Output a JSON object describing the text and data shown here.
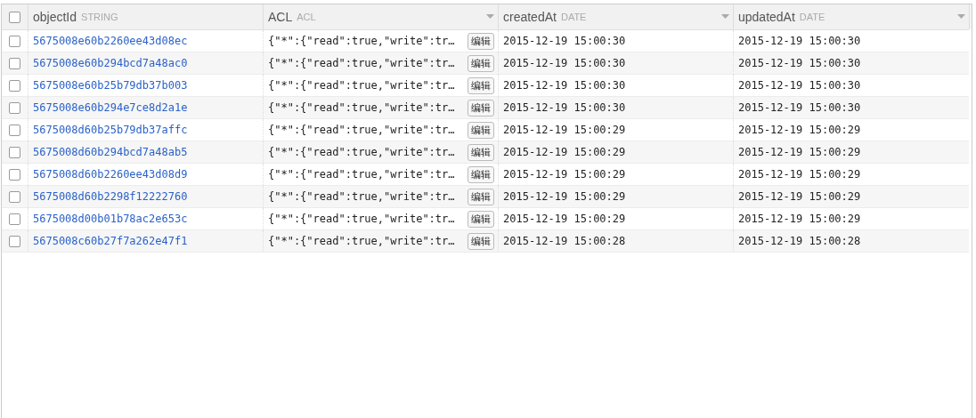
{
  "table": {
    "select_all": {
      "checked": false
    },
    "columns": [
      {
        "name": "objectId",
        "type": "STRING",
        "menu": false
      },
      {
        "name": "ACL",
        "type": "ACL",
        "menu": true
      },
      {
        "name": "createdAt",
        "type": "DATE",
        "menu": true
      },
      {
        "name": "updatedAt",
        "type": "DATE",
        "menu": true
      }
    ],
    "rows": [
      {
        "checked": false,
        "objectId": "5675008e60b2260ee43d08ec",
        "acl": "{\"*\":{\"read\":true,\"write\":tr…",
        "edit": "编辑",
        "createdAt": "2015-12-19 15:00:30",
        "updatedAt": "2015-12-19 15:00:30"
      },
      {
        "checked": false,
        "objectId": "5675008e60b294bcd7a48ac0",
        "acl": "{\"*\":{\"read\":true,\"write\":tr…",
        "edit": "编辑",
        "createdAt": "2015-12-19 15:00:30",
        "updatedAt": "2015-12-19 15:00:30"
      },
      {
        "checked": false,
        "objectId": "5675008e60b25b79db37b003",
        "acl": "{\"*\":{\"read\":true,\"write\":tr…",
        "edit": "编辑",
        "createdAt": "2015-12-19 15:00:30",
        "updatedAt": "2015-12-19 15:00:30"
      },
      {
        "checked": false,
        "objectId": "5675008e60b294e7ce8d2a1e",
        "acl": "{\"*\":{\"read\":true,\"write\":tr…",
        "edit": "编辑",
        "createdAt": "2015-12-19 15:00:30",
        "updatedAt": "2015-12-19 15:00:30"
      },
      {
        "checked": false,
        "objectId": "5675008d60b25b79db37affc",
        "acl": "{\"*\":{\"read\":true,\"write\":tr…",
        "edit": "编辑",
        "createdAt": "2015-12-19 15:00:29",
        "updatedAt": "2015-12-19 15:00:29"
      },
      {
        "checked": false,
        "objectId": "5675008d60b294bcd7a48ab5",
        "acl": "{\"*\":{\"read\":true,\"write\":tr…",
        "edit": "编辑",
        "createdAt": "2015-12-19 15:00:29",
        "updatedAt": "2015-12-19 15:00:29"
      },
      {
        "checked": false,
        "objectId": "5675008d60b2260ee43d08d9",
        "acl": "{\"*\":{\"read\":true,\"write\":tr…",
        "edit": "编辑",
        "createdAt": "2015-12-19 15:00:29",
        "updatedAt": "2015-12-19 15:00:29"
      },
      {
        "checked": false,
        "objectId": "5675008d60b2298f12222760",
        "acl": "{\"*\":{\"read\":true,\"write\":tr…",
        "edit": "编辑",
        "createdAt": "2015-12-19 15:00:29",
        "updatedAt": "2015-12-19 15:00:29"
      },
      {
        "checked": false,
        "objectId": "5675008d00b01b78ac2e653c",
        "acl": "{\"*\":{\"read\":true,\"write\":tr…",
        "edit": "编辑",
        "createdAt": "2015-12-19 15:00:29",
        "updatedAt": "2015-12-19 15:00:29"
      },
      {
        "checked": false,
        "objectId": "5675008c60b27f7a262e47f1",
        "acl": "{\"*\":{\"read\":true,\"write\":tr…",
        "edit": "编辑",
        "createdAt": "2015-12-19 15:00:28",
        "updatedAt": "2015-12-19 15:00:28"
      }
    ]
  }
}
